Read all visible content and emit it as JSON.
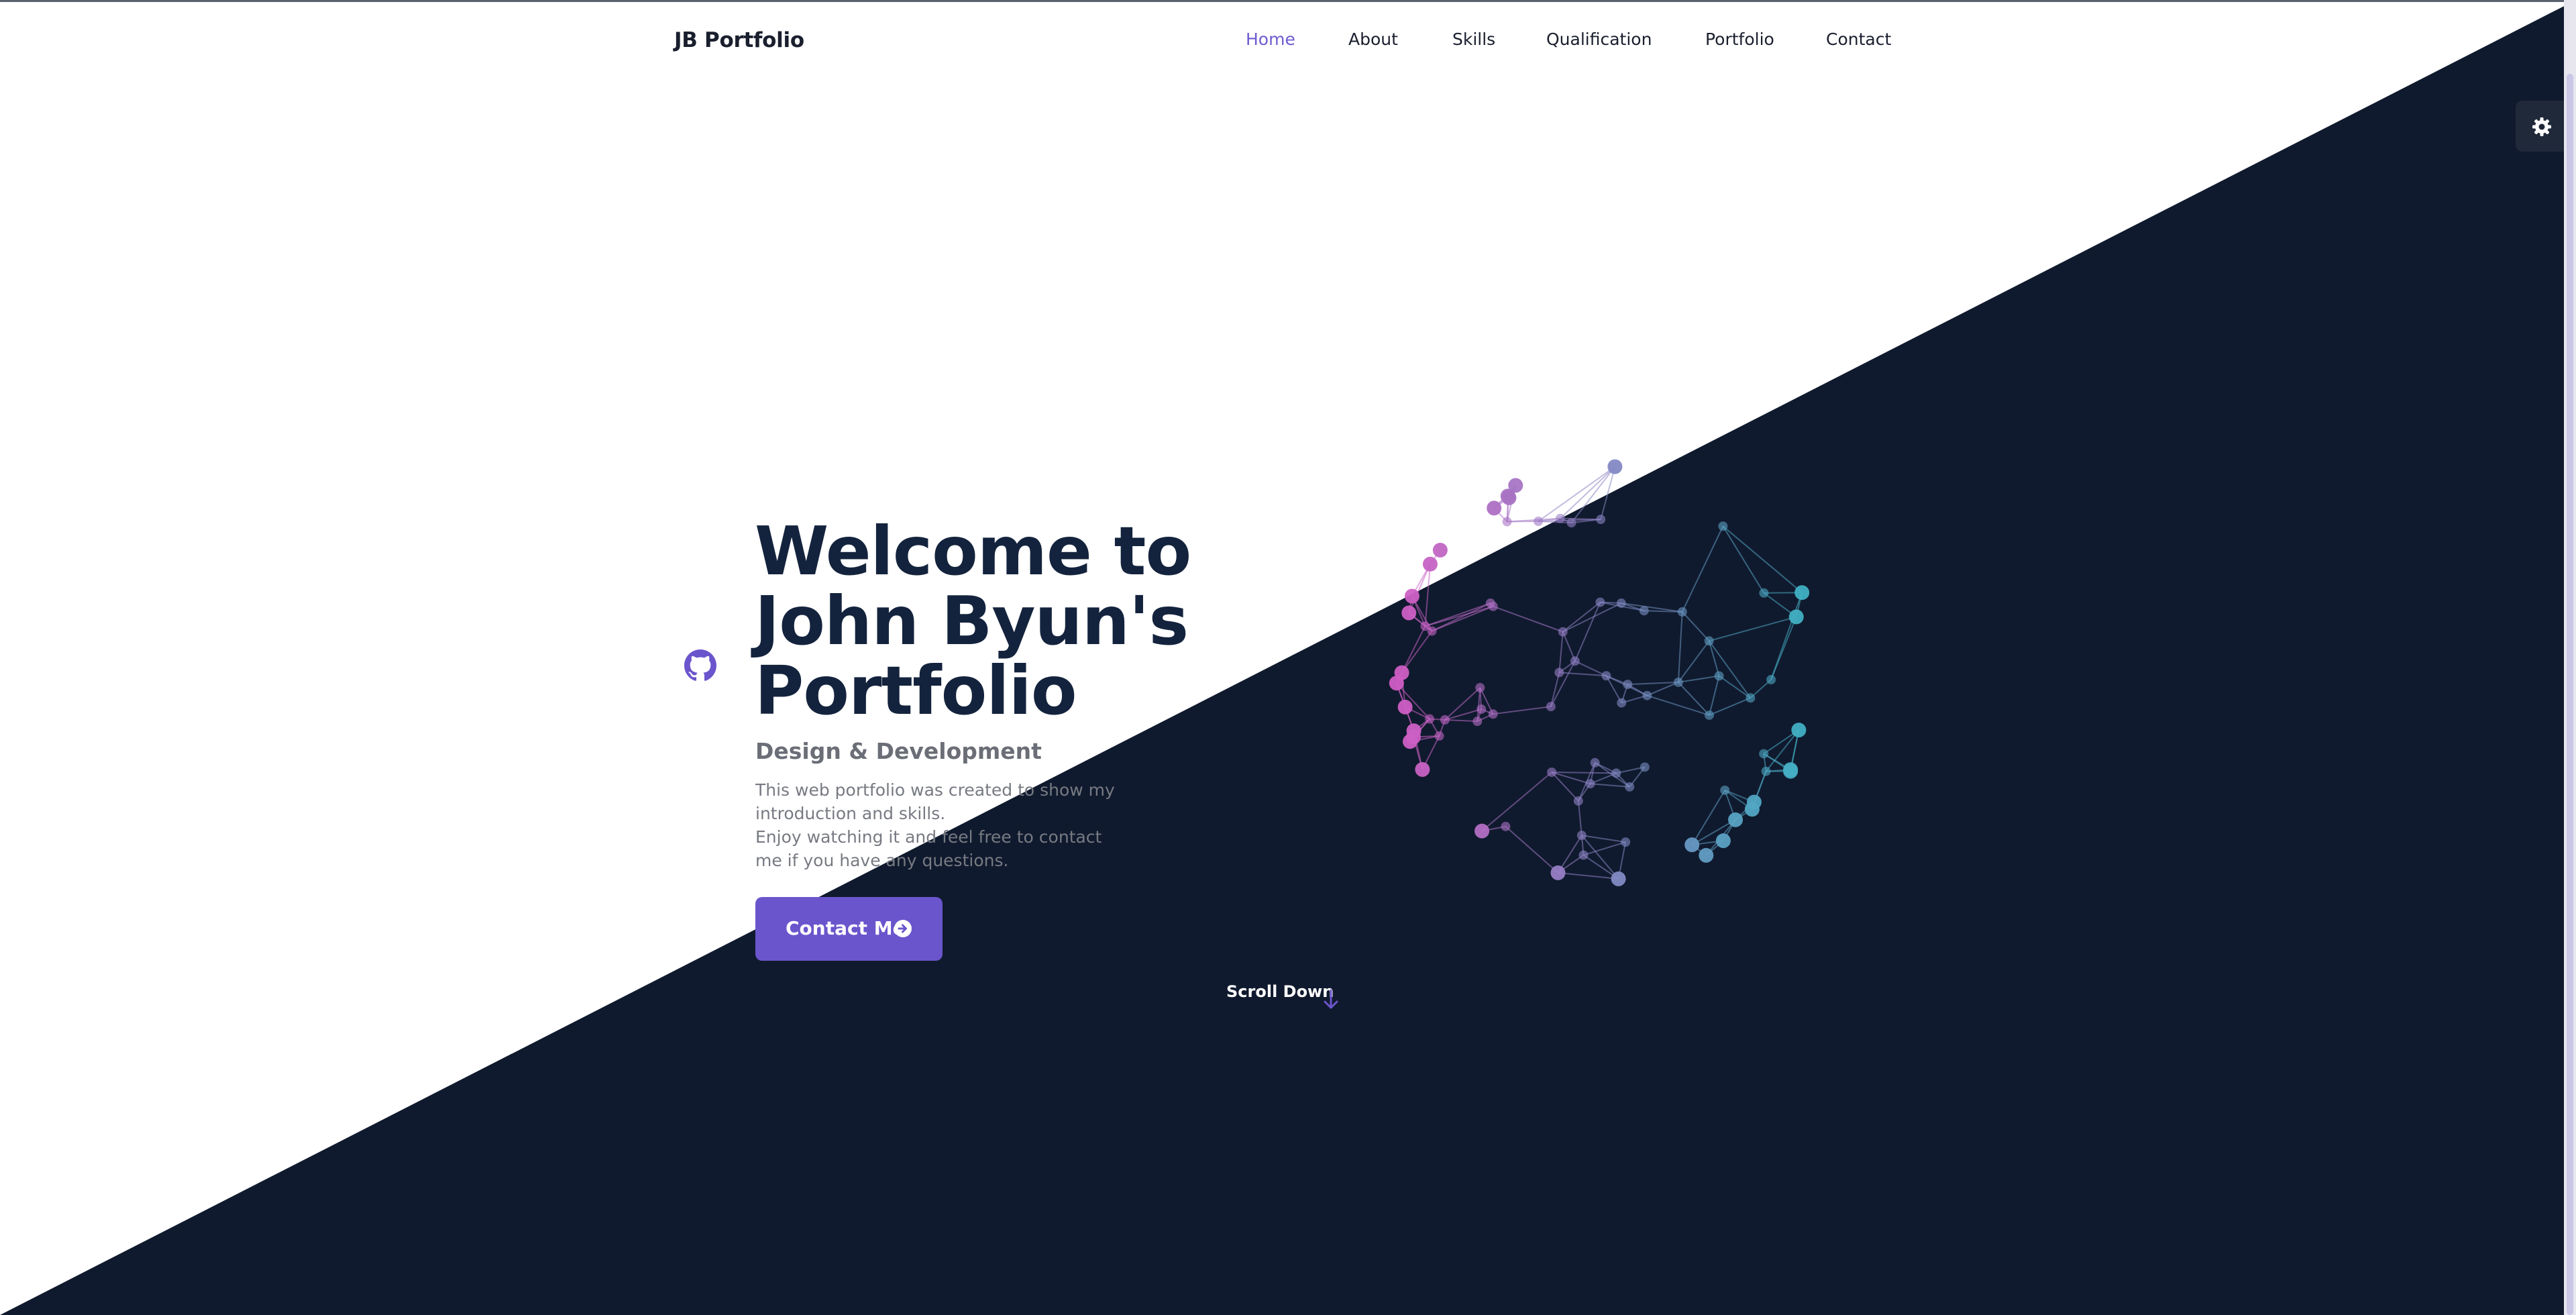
{
  "header": {
    "logo": "JB Portfolio",
    "nav": [
      "Home",
      "About",
      "Skills",
      "Qualification",
      "Portfolio",
      "Contact"
    ],
    "active_nav": "Home"
  },
  "hero": {
    "title_lines": [
      "Welcome to",
      "John Byun's",
      "Portfolio"
    ],
    "subtitle": "Design & Development",
    "description_lines": [
      "This web portfolio was created to show my",
      "introduction and skills.",
      "Enjoy watching it and feel free to contact",
      "me if you have any questions."
    ],
    "contact_button": "Contact Me",
    "scroll_down": "Scroll Down"
  },
  "icons": {
    "github": "github-icon",
    "theme_toggle": "gear-icon",
    "contact_arrow": "arrow-right-circle-icon",
    "scroll_arrow": "arrow-down-icon"
  },
  "colors": {
    "dark_bg": "#101a2e",
    "light_bg": "#ffffff",
    "accent": "#6b55cc",
    "title": "#14233d",
    "sphere_left": "#d45bc4",
    "sphere_right": "#3ab3c3"
  }
}
